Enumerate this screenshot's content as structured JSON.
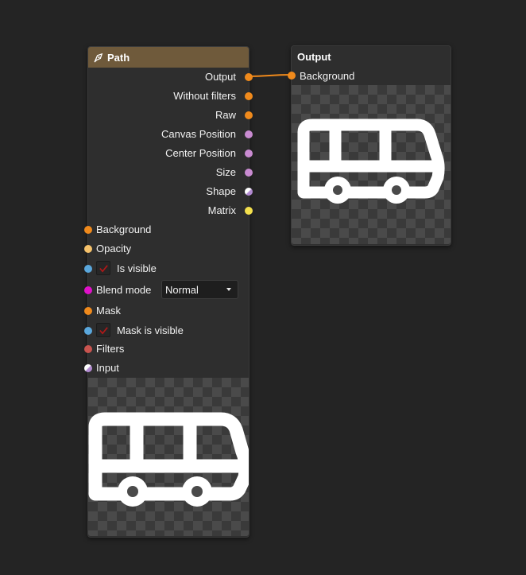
{
  "path_node": {
    "title": "Path",
    "outputs": [
      {
        "label": "Output",
        "color": "#f08a1c"
      },
      {
        "label": "Without filters",
        "color": "#f08a1c"
      },
      {
        "label": "Raw",
        "color": "#f08a1c"
      },
      {
        "label": "Canvas Position",
        "color": "#c98bd1"
      },
      {
        "label": "Center Position",
        "color": "#c98bd1"
      },
      {
        "label": "Size",
        "color": "#c98bd1"
      },
      {
        "label": "Shape",
        "color": "#d9b0e0"
      },
      {
        "label": "Matrix",
        "color": "#f4e04d"
      }
    ],
    "inputs": {
      "background": "Background",
      "opacity": "Opacity",
      "is_visible": "Is visible",
      "blend_mode": "Blend mode",
      "blend_mode_value": "Normal",
      "mask": "Mask",
      "mask_is_visible": "Mask is visible",
      "filters": "Filters",
      "input": "Input"
    },
    "is_visible_checked": true,
    "mask_is_visible_checked": true
  },
  "output_node": {
    "title": "Output",
    "input_label": "Background"
  },
  "colors": {
    "orange": "#f08a1c",
    "light_orange": "#f6c26b",
    "blue": "#5aa7dc",
    "magenta": "#e011c9",
    "red": "#c9544f",
    "purple": "#c98bd1",
    "yellow": "#f4e04d",
    "header_brown": "#6f5a3b",
    "check_red": "#b01818"
  },
  "icons": {
    "path_node_icon": "path-pen-icon",
    "preview": "bus-icon"
  }
}
